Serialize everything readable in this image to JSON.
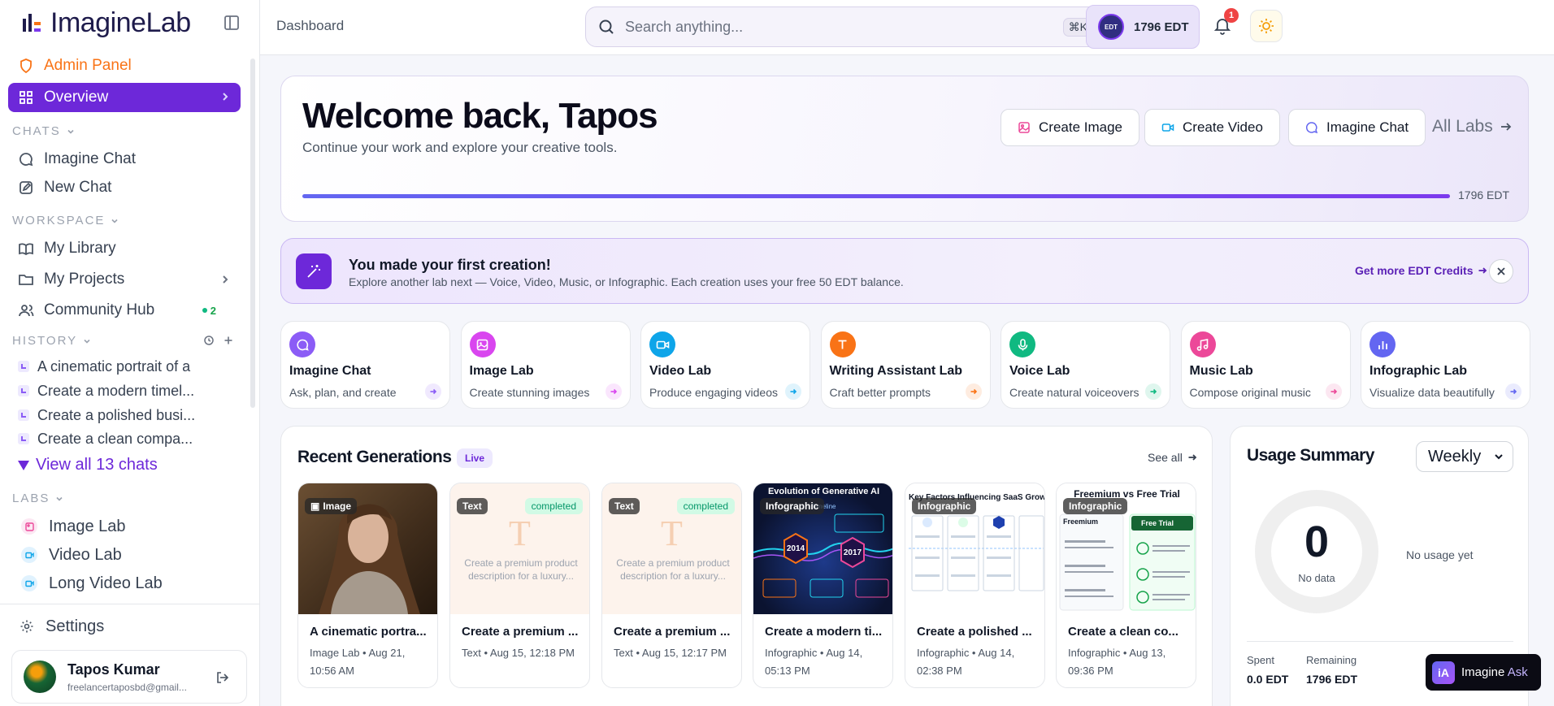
{
  "app": {
    "brand": "ImagineLab"
  },
  "sidebar": {
    "admin_label": "Admin Panel",
    "overview_label": "Overview",
    "chats_section": "CHATS",
    "chats": [
      {
        "label": "Imagine Chat"
      },
      {
        "label": "New Chat"
      }
    ],
    "workspace_section": "WORKSPACE",
    "workspace": [
      {
        "label": "My Library"
      },
      {
        "label": "My Projects"
      },
      {
        "label": "Community Hub",
        "badge": "2"
      }
    ],
    "history_section": "HISTORY",
    "history": [
      {
        "label": "A cinematic portrait of a"
      },
      {
        "label": "Create a modern timel..."
      },
      {
        "label": "Create a polished busi..."
      },
      {
        "label": "Create a clean compa..."
      }
    ],
    "view_all_label": "View all 13 chats",
    "labs_section": "LABS",
    "labs": [
      {
        "label": "Image Lab",
        "color": "#ec4899"
      },
      {
        "label": "Video Lab",
        "color": "#0ea5e9"
      },
      {
        "label": "Long Video Lab",
        "color": "#0ea5e9"
      }
    ],
    "settings_label": "Settings",
    "user": {
      "name": "Tapos Kumar",
      "email": "freelancertaposbd@gmail..."
    }
  },
  "topbar": {
    "breadcrumb": "Dashboard",
    "search_placeholder": "Search anything...",
    "search_shortcut": "⌘K",
    "credits_coin": "EDT",
    "credits": "1796 EDT",
    "notification_count": "1"
  },
  "hero": {
    "title": "Welcome back, Tapos",
    "subtitle": "Continue your work and explore your creative tools.",
    "buttons": [
      {
        "label": "Create Image",
        "color": "#ec4899"
      },
      {
        "label": "Create Video",
        "color": "#0ea5e9"
      },
      {
        "label": "Imagine Chat",
        "color": "#6366f1"
      }
    ],
    "all_labs_label": "All Labs",
    "progress_fraction": 1.0,
    "progress_label": "1796 EDT"
  },
  "banner": {
    "title": "You made your first creation!",
    "text": "Explore another lab next — Voice, Video, Music, or Infographic. Each creation uses your free 50 EDT balance.",
    "link": "Get more EDT Credits"
  },
  "labs": [
    {
      "name": "Imagine Chat",
      "desc": "Ask, plan, and create",
      "color": "#8b5cf6",
      "icon": "chat-icon"
    },
    {
      "name": "Image Lab",
      "desc": "Create stunning images",
      "color": "#d946ef",
      "icon": "image-icon"
    },
    {
      "name": "Video Lab",
      "desc": "Produce engaging videos",
      "color": "#0ea5e9",
      "icon": "video-icon"
    },
    {
      "name": "Writing Assistant Lab",
      "desc": "Craft better prompts",
      "color": "#f97316",
      "icon": "text-icon"
    },
    {
      "name": "Voice Lab",
      "desc": "Create natural voiceovers",
      "color": "#10b981",
      "icon": "mic-icon"
    },
    {
      "name": "Music Lab",
      "desc": "Compose original music",
      "color": "#ec4899",
      "icon": "music-icon"
    },
    {
      "name": "Infographic Lab",
      "desc": "Visualize data beautifully",
      "color": "#6366f1",
      "icon": "bar-chart-icon"
    }
  ],
  "recent": {
    "title": "Recent Generations",
    "live_label": "Live",
    "see_all_label": "See all",
    "items": [
      {
        "tag": "Image",
        "status": "",
        "title": "A cinematic portra...",
        "meta": "Image Lab • Aug 21, 10:56 AM",
        "thumb": "portrait"
      },
      {
        "tag": "Text",
        "status": "completed",
        "title": "Create a premium ...",
        "meta": "Text • Aug 15, 12:18 PM",
        "thumb": "text",
        "thumb_text": "Create a premium product description for a luxury..."
      },
      {
        "tag": "Text",
        "status": "completed",
        "title": "Create a premium ...",
        "meta": "Text • Aug 15, 12:17 PM",
        "thumb": "text",
        "thumb_text": "Create a premium product description for a luxury..."
      },
      {
        "tag": "Infographic",
        "status": "",
        "title": "Create a modern ti...",
        "meta": "Infographic • Aug 14, 05:13 PM",
        "thumb": "timeline",
        "thumb_heading": "Evolution of Generative AI",
        "thumb_sub": "Timeline",
        "years": [
          "2014",
          "2017"
        ]
      },
      {
        "tag": "Infographic",
        "status": "",
        "title": "Create a polished ...",
        "meta": "Infographic • Aug 14, 02:38 PM",
        "thumb": "saas",
        "thumb_heading": "Key Factors Influencing SaaS Growth"
      },
      {
        "tag": "Infographic",
        "status": "",
        "title": "Create a clean co...",
        "meta": "Infographic • Aug 13, 09:36 PM",
        "thumb": "freemium",
        "thumb_heading": "Freemium vs Free Trial",
        "left_col": "Freemium",
        "right_col": "Free Trial"
      }
    ]
  },
  "usage": {
    "title": "Usage Summary",
    "period": "Weekly",
    "value": "0",
    "value_label": "No data",
    "empty_text": "No usage yet",
    "spent_label": "Spent",
    "spent_value": "0.0 EDT",
    "remaining_label": "Remaining",
    "remaining_value": "1796 EDT"
  },
  "ask": {
    "logo_text": "iA",
    "label_a": "Imagine",
    "label_b": "Ask"
  }
}
